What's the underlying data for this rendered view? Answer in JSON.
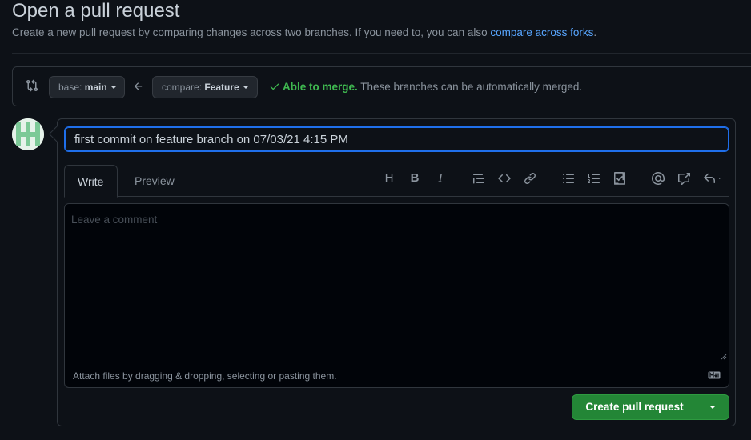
{
  "header": {
    "title": "Open a pull request",
    "subtitle": "Create a new pull request by comparing changes across two branches. If you need to, you can also ",
    "subtitle_link": "compare across forks",
    "subtitle_end": "."
  },
  "range": {
    "base_prefix": "base: ",
    "base_branch": "main",
    "compare_prefix": "compare: ",
    "compare_branch": "Feature",
    "merge_ok": "Able to merge.",
    "merge_msg": " These branches can be automatically merged."
  },
  "form": {
    "title_value": "first commit on feature branch on 07/03/21 4:15 PM",
    "tabs": {
      "write": "Write",
      "preview": "Preview"
    },
    "toolbar": {
      "heading": "H",
      "bold": "B",
      "italic": "I",
      "quote": "quote-icon",
      "code": "code-icon",
      "link": "link-icon",
      "unordered_list": "list-unordered-icon",
      "ordered_list": "list-ordered-icon",
      "tasklist": "tasklist-icon",
      "mention": "mention-icon",
      "reference": "cross-reference-icon",
      "reply": "reply-icon"
    },
    "comment_placeholder": "Leave a comment",
    "attach_text": "Attach files by dragging & dropping, selecting or pasting them.",
    "submit_label": "Create pull request"
  },
  "colors": {
    "background": "#0d1117",
    "accent_blue": "#58a6ff",
    "success_green": "#3fb950",
    "button_green": "#238636"
  }
}
